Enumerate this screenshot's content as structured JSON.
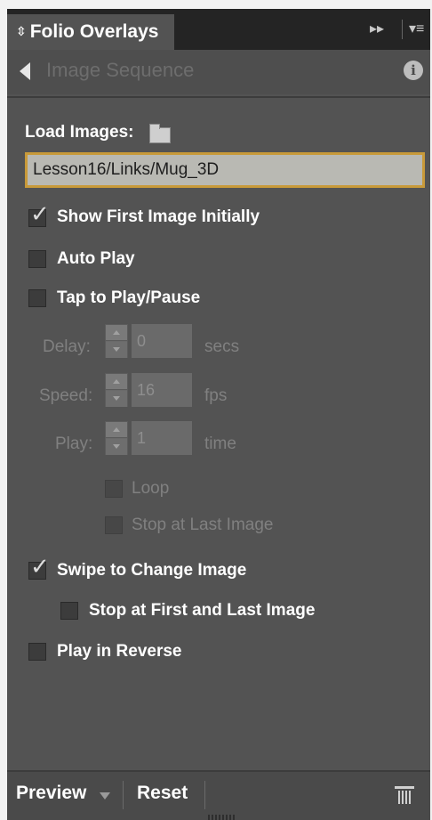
{
  "tabbar": {
    "panel_title": "Folio Overlays",
    "tab_arrows_icon": "⇳",
    "collapse_icon": "▸▸",
    "menu_icon": "▾≡"
  },
  "header": {
    "back_icon": "triangle-left",
    "title": "Image Sequence",
    "info_icon": "i"
  },
  "load_images": {
    "label": "Load Images:",
    "path_value": "Lesson16/Links/Mug_3D"
  },
  "options": {
    "show_first_image": {
      "label": "Show First Image Initially",
      "checked": true
    },
    "auto_play": {
      "label": "Auto Play",
      "checked": false
    },
    "tap_to_play": {
      "label": "Tap to Play/Pause",
      "checked": false
    },
    "swipe_to_change": {
      "label": "Swipe to Change Image",
      "checked": true
    },
    "stop_first_last": {
      "label": "Stop at First and Last Image",
      "checked": false
    },
    "play_in_reverse": {
      "label": "Play in Reverse",
      "checked": false
    }
  },
  "playback": {
    "delay": {
      "label": "Delay:",
      "value": "0",
      "unit": "secs"
    },
    "speed": {
      "label": "Speed:",
      "value": "16",
      "unit": "fps"
    },
    "play": {
      "label": "Play:",
      "value": "1",
      "unit": "time"
    },
    "loop": {
      "label": "Loop",
      "checked": false
    },
    "stop_last": {
      "label": "Stop at Last Image",
      "checked": false
    }
  },
  "footer": {
    "preview_label": "Preview",
    "reset_label": "Reset"
  },
  "colors": {
    "panel_bg": "#535353",
    "field_border_accent": "#c89a3a",
    "tabbar_bg": "#242424"
  }
}
